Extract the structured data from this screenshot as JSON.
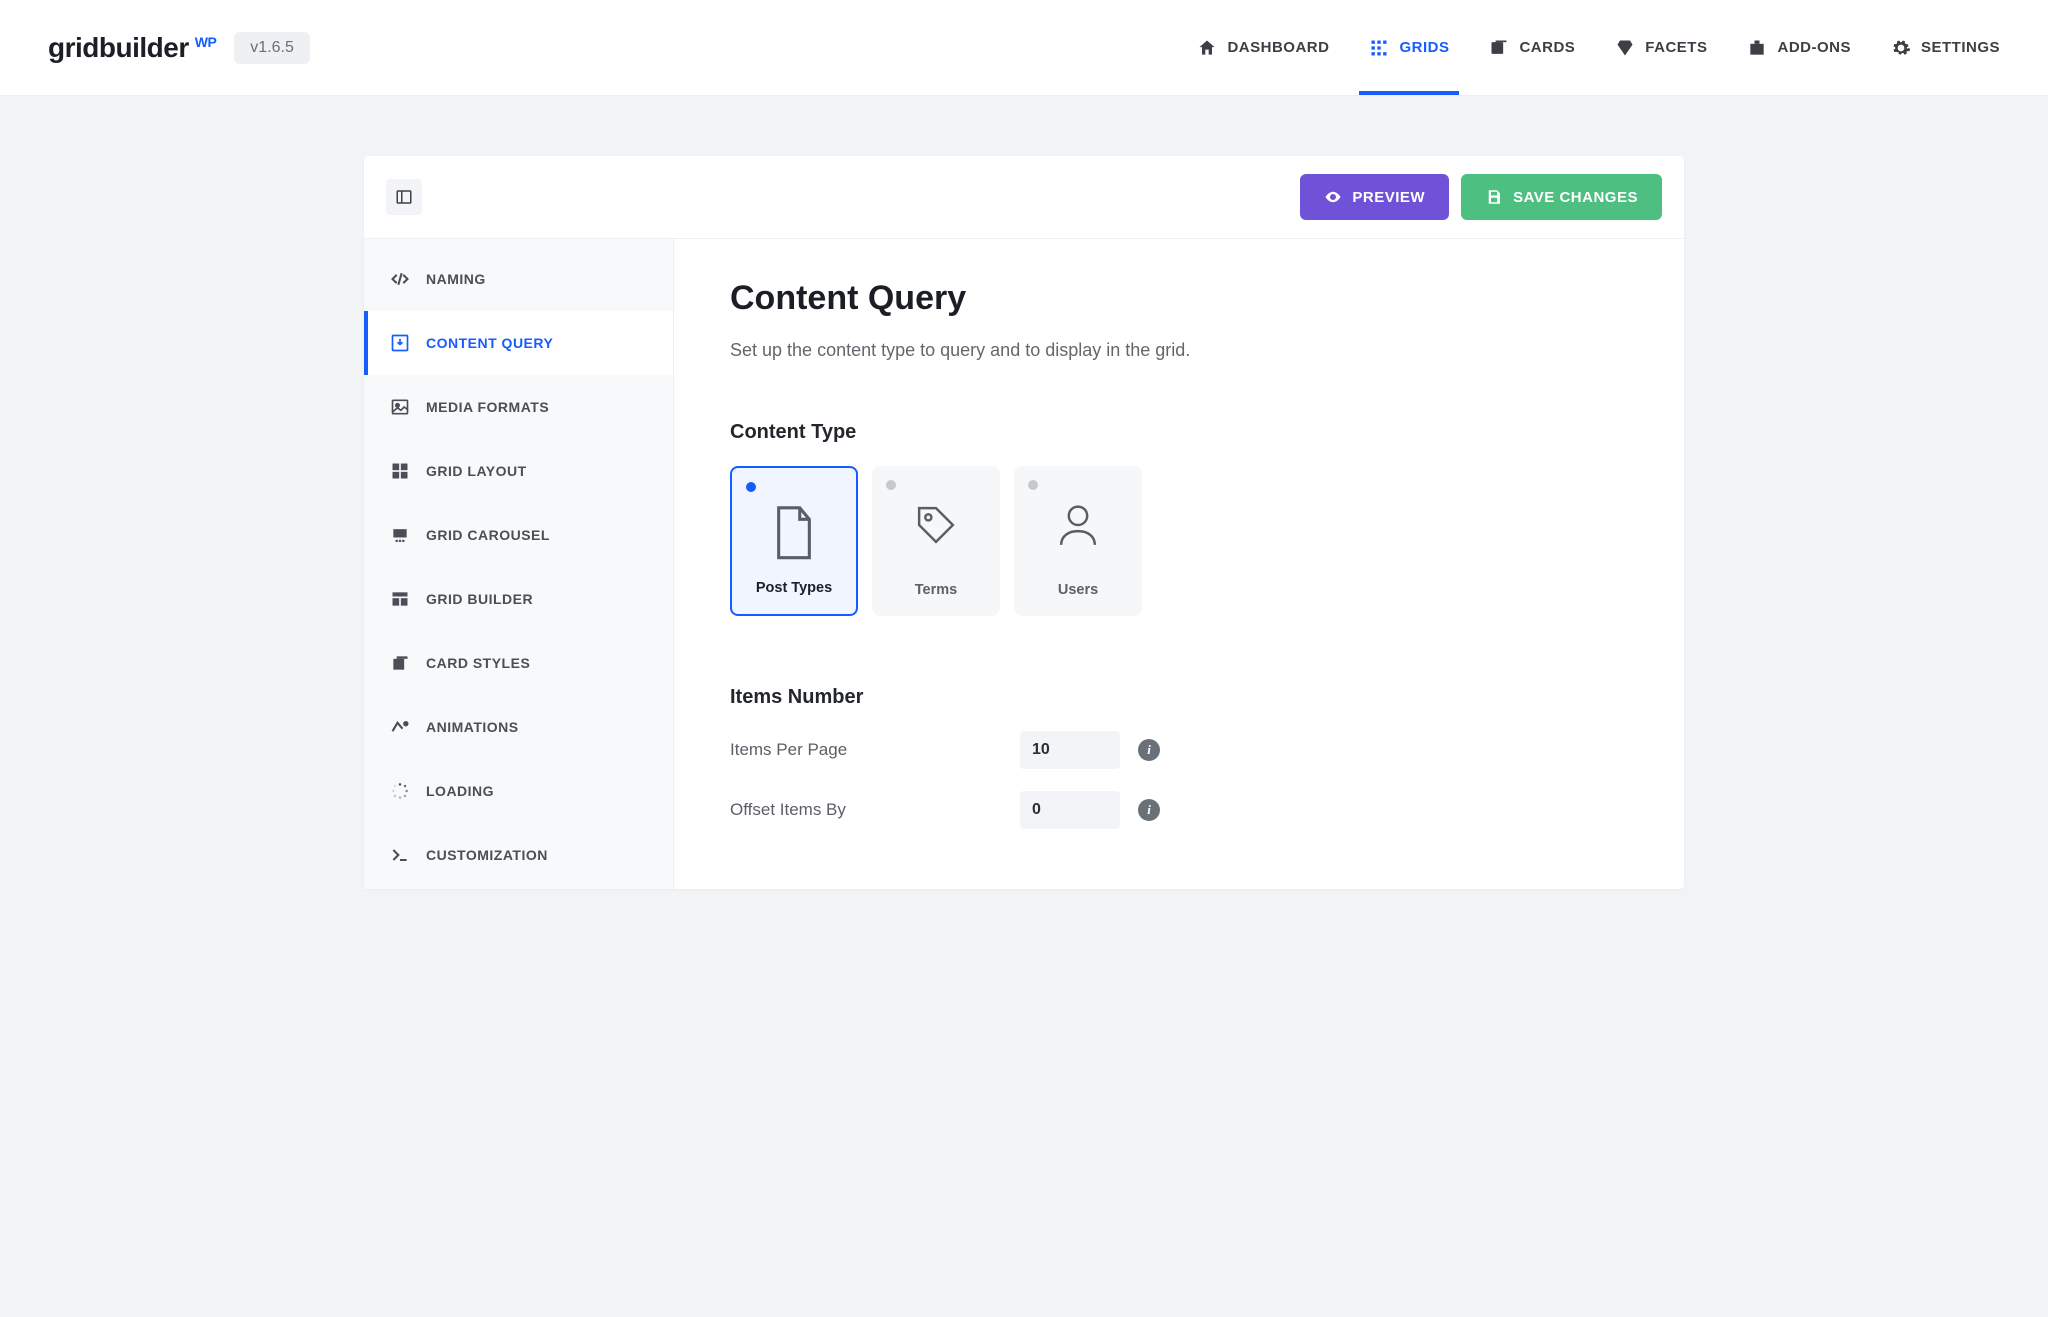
{
  "brand": {
    "name": "gridbuilder",
    "suffix": "WP"
  },
  "version": "v1.6.5",
  "topnav": [
    {
      "id": "dashboard",
      "label": "DASHBOARD",
      "icon": "home-icon"
    },
    {
      "id": "grids",
      "label": "GRIDS",
      "icon": "grid-icon",
      "active": true
    },
    {
      "id": "cards",
      "label": "CARDS",
      "icon": "cards-icon"
    },
    {
      "id": "facets",
      "label": "FACETS",
      "icon": "diamond-icon"
    },
    {
      "id": "addons",
      "label": "ADD-ONS",
      "icon": "addon-icon"
    },
    {
      "id": "settings",
      "label": "SETTINGS",
      "icon": "gear-icon"
    }
  ],
  "actions": {
    "preview": "PREVIEW",
    "save": "SAVE CHANGES"
  },
  "sidebar": [
    {
      "id": "naming",
      "label": "NAMING",
      "icon": "code-icon"
    },
    {
      "id": "content-query",
      "label": "CONTENT QUERY",
      "icon": "download-box-icon",
      "active": true
    },
    {
      "id": "media-formats",
      "label": "MEDIA FORMATS",
      "icon": "image-icon"
    },
    {
      "id": "grid-layout",
      "label": "GRID LAYOUT",
      "icon": "layout-icon"
    },
    {
      "id": "grid-carousel",
      "label": "GRID CAROUSEL",
      "icon": "carousel-icon"
    },
    {
      "id": "grid-builder",
      "label": "GRID BUILDER",
      "icon": "builder-icon"
    },
    {
      "id": "card-styles",
      "label": "CARD STYLES",
      "icon": "stack-icon"
    },
    {
      "id": "animations",
      "label": "ANIMATIONS",
      "icon": "animation-icon"
    },
    {
      "id": "loading",
      "label": "LOADING",
      "icon": "spinner-icon"
    },
    {
      "id": "customization",
      "label": "CUSTOMIZATION",
      "icon": "prompt-icon"
    }
  ],
  "page": {
    "title": "Content Query",
    "subtitle": "Set up the content type to query and to display in the grid.",
    "content_type_label": "Content Type",
    "content_types": [
      {
        "id": "post-types",
        "label": "Post Types",
        "icon": "file-icon",
        "selected": true
      },
      {
        "id": "terms",
        "label": "Terms",
        "icon": "tag-icon"
      },
      {
        "id": "users",
        "label": "Users",
        "icon": "user-icon"
      }
    ],
    "items_number_label": "Items Number",
    "fields": {
      "items_per_page": {
        "label": "Items Per Page",
        "value": "10"
      },
      "offset_items_by": {
        "label": "Offset Items By",
        "value": "0"
      }
    }
  }
}
